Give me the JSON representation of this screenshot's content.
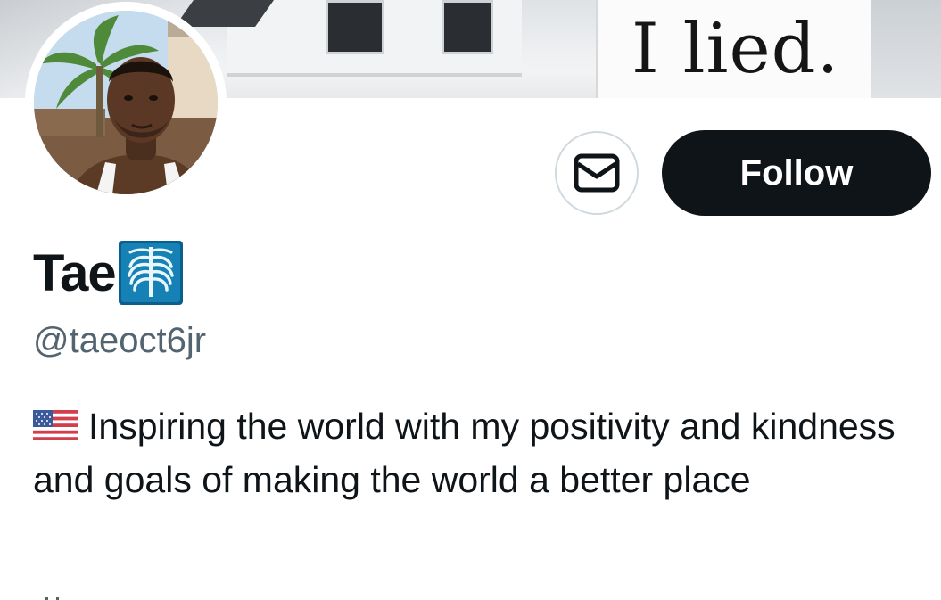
{
  "banner": {
    "meme_text": "I lied."
  },
  "profile": {
    "display_name": "Tae",
    "name_emoji": "x-ray-icon",
    "handle": "@taeoct6jr",
    "bio_flag": "us-flag-icon",
    "bio": "Inspiring the world with my positivity and kindness and goals of making the world a better place"
  },
  "actions": {
    "message_icon": "envelope-icon",
    "follow_label": "Follow"
  },
  "colors": {
    "follow_bg": "#0f1419",
    "follow_text": "#ffffff",
    "handle": "#536471",
    "border": "#cfd9de"
  }
}
